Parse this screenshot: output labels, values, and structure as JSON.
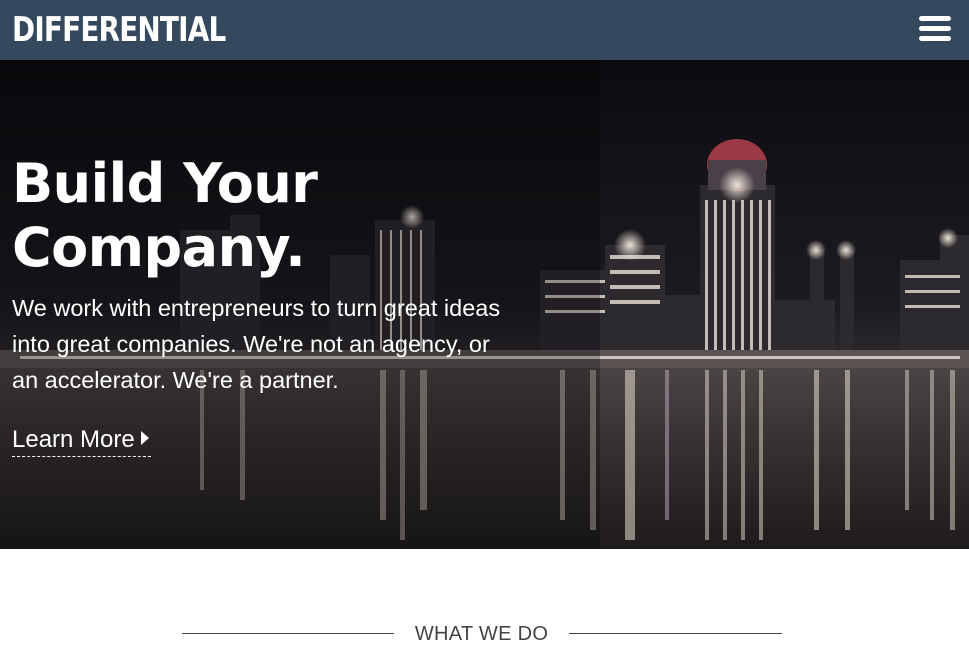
{
  "header": {
    "logo_text": "DIFFERENTIAL",
    "menu_icon": "hamburger-menu-icon",
    "background_color": "#34495e"
  },
  "hero": {
    "title_line1": "Build Your",
    "title_line2": "Company.",
    "body_line1": "We work with entrepreneurs to turn great ideas",
    "body_line2": "into great companies. We're not an agency, or",
    "body_line3": "an accelerator. We're a partner.",
    "cta_label": "Learn More",
    "cta_icon": "caret-right-icon",
    "background": "night city skyline reflected in river"
  },
  "section": {
    "heading": "WHAT WE DO"
  }
}
